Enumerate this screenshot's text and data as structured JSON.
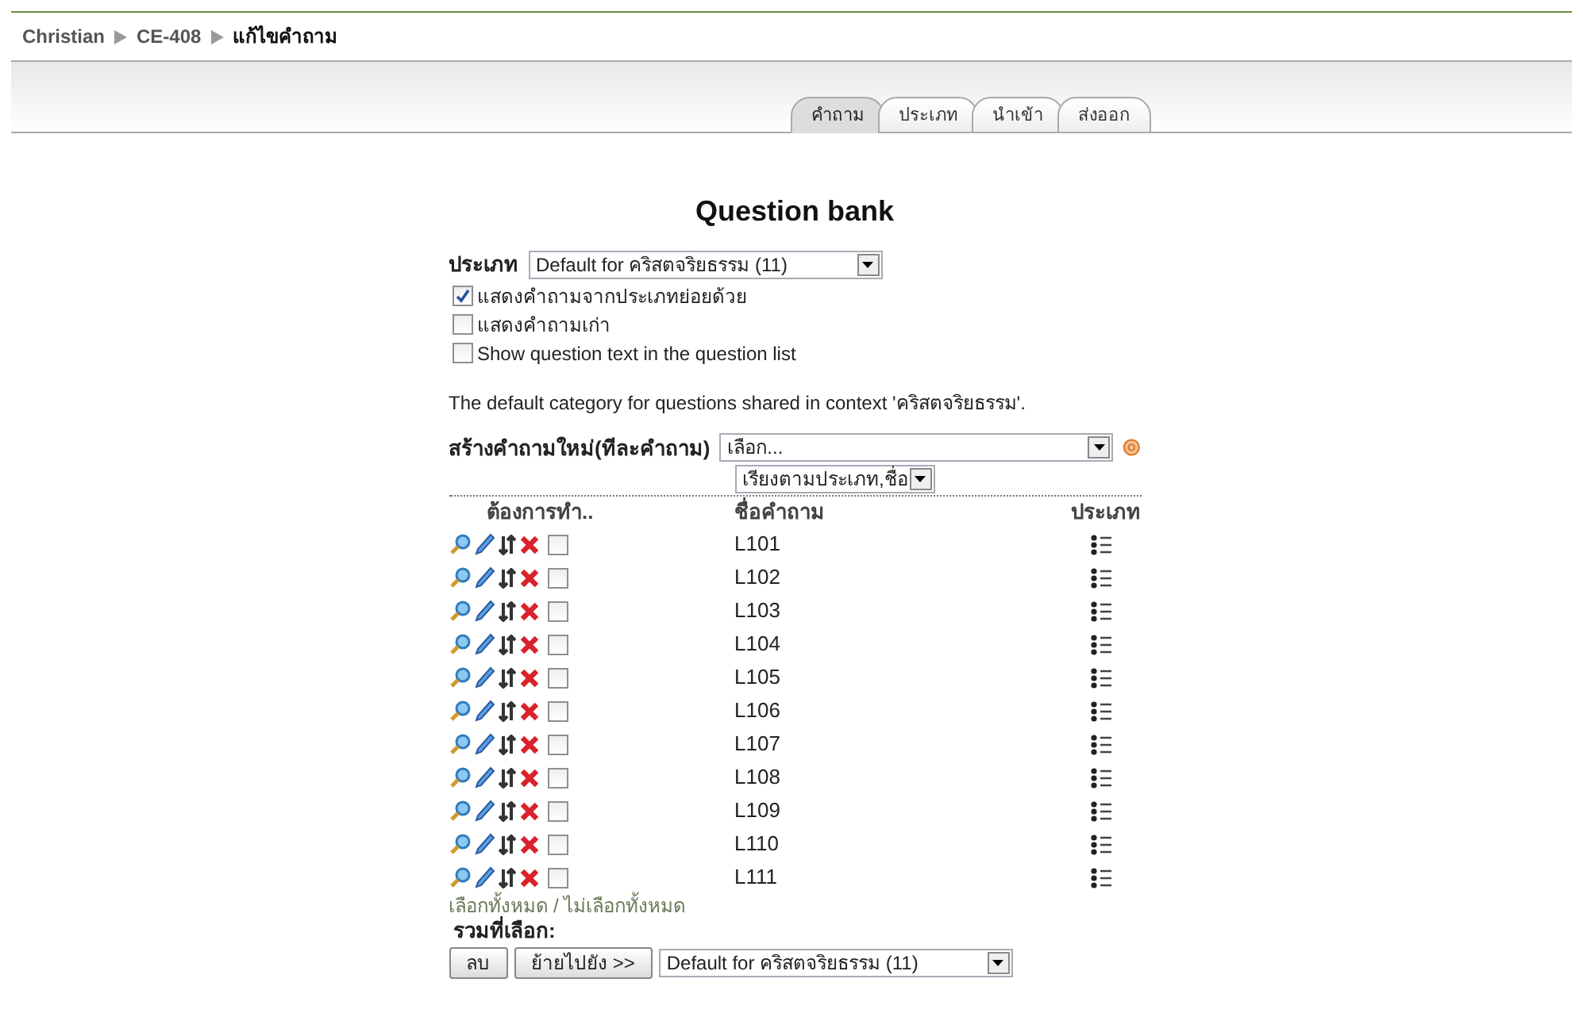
{
  "breadcrumb": [
    {
      "label": "Christian",
      "link": true
    },
    {
      "label": "CE-408",
      "link": true
    },
    {
      "label": "แก้ไขคำถาม",
      "link": false
    }
  ],
  "tabs": [
    {
      "label": "คำถาม",
      "selected": true
    },
    {
      "label": "ประเภท",
      "selected": false
    },
    {
      "label": "นำเข้า",
      "selected": false
    },
    {
      "label": "ส่งออก",
      "selected": false
    }
  ],
  "title": "Question bank",
  "category": {
    "label": "ประเภท",
    "value": "Default for คริสตจริยธรรม (11)"
  },
  "options": [
    {
      "label": "แสดงคำถามจากประเภทย่อยด้วย",
      "checked": true
    },
    {
      "label": "แสดงคำถามเก่า",
      "checked": false
    },
    {
      "label": "Show question text in the question list",
      "checked": false
    }
  ],
  "context_note": "The default category for questions shared in context 'คริสตจริยธรรม'.",
  "create": {
    "label": "สร้างคำถามใหม่(ทีละคำถาม)",
    "value": "เลือก..."
  },
  "sort": {
    "value": "เรียงตามประเภท,ชื่อ"
  },
  "table": {
    "columns": [
      "ต้องการทำ..",
      "ชื่อคำถาม",
      "ประเภท"
    ],
    "rows": [
      {
        "name": "L101",
        "checked": false
      },
      {
        "name": "L102",
        "checked": false
      },
      {
        "name": "L103",
        "checked": false
      },
      {
        "name": "L104",
        "checked": false
      },
      {
        "name": "L105",
        "checked": false
      },
      {
        "name": "L106",
        "checked": false
      },
      {
        "name": "L107",
        "checked": false
      },
      {
        "name": "L108",
        "checked": false
      },
      {
        "name": "L109",
        "checked": false
      },
      {
        "name": "L110",
        "checked": false
      },
      {
        "name": "L111",
        "checked": false
      }
    ]
  },
  "select_all": "เลือกทั้งหมด",
  "separator": "/",
  "deselect_all": "ไม่เลือกทั้งหมด",
  "selected_label": "รวมที่เลือก:",
  "buttons": [
    "ลบ",
    "ย้ายไปยัง >>"
  ],
  "move_target": "Default for คริสตจริยธรรม (11)"
}
